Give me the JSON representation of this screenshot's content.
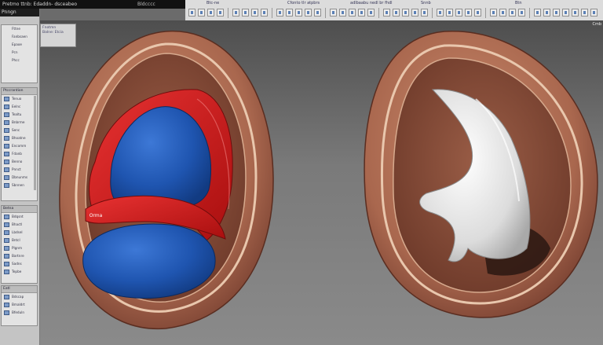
{
  "titlebar": {
    "left_text": "Pretmo ttnb: Edaddn- dsceabeo",
    "right_text": "Bldcccc"
  },
  "toolbar": {
    "top_labels": [
      "Btc-ne",
      "Cfonto tlr atpbrs",
      "adlbaabu nedl br fhdl",
      "Snnb",
      "Btn"
    ],
    "right_label": "Cmb"
  },
  "left_panel": {
    "header": "Pnngn",
    "top_items": [
      "Fttne",
      "Fanbsaen",
      "Epaoe",
      "Pcn",
      "Phcc"
    ],
    "sub_panel_items": [
      "Fnotmn",
      "Balne: Etcia"
    ],
    "mid_header": "Ptccrantion",
    "mid_items": [
      "Tenuo",
      "Eelnc",
      "Tealtu",
      "Bnbrme",
      "Senc",
      "Bhoatne",
      "Encomm",
      "Fdanb",
      "Benno",
      "Pnnct",
      "Dbnunms",
      "Sbnnen"
    ],
    "lower_header": "Betna",
    "lower_items": [
      "Bdqsnt",
      "Bhactl",
      "Lbdsel",
      "Bntcl",
      "Plgnm",
      "Bartnre",
      "Sadns",
      "Tepbe"
    ],
    "bottom_header": "Eatl",
    "bottom_items": [
      "Bdscap",
      "Bmaldrt",
      "Bfeduln"
    ]
  },
  "viewport": {
    "scene_label": "Orma"
  },
  "colors": {
    "flesh": "#b0735a",
    "flesh_light": "#d7a88c",
    "blue": "#1f55b0",
    "red": "#d11d1d",
    "white_tissue": "#e9e9e9"
  }
}
